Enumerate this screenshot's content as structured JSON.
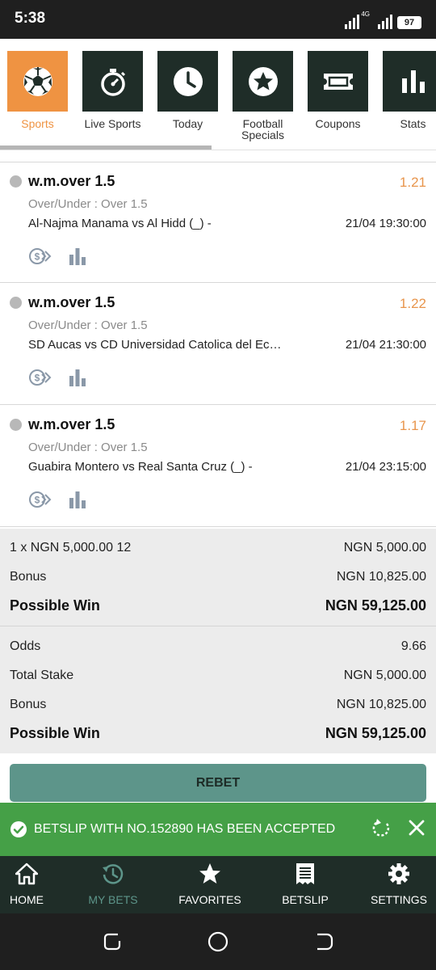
{
  "status_bar": {
    "time": "5:38",
    "network": "4G",
    "battery": "97"
  },
  "categories": [
    {
      "label": "Sports",
      "icon": "soccer-ball-icon",
      "active": true
    },
    {
      "label": "Live Sports",
      "icon": "stopwatch-icon",
      "active": false
    },
    {
      "label": "Today",
      "icon": "clock-icon",
      "active": false
    },
    {
      "label": "Football Specials",
      "icon": "star-icon",
      "active": false
    },
    {
      "label": "Coupons",
      "icon": "ticket-icon",
      "active": false
    },
    {
      "label": "Stats",
      "icon": "bar-chart-icon",
      "active": false
    }
  ],
  "bets": [
    {
      "title": "w.m.over 1.5",
      "odds": "1.21",
      "market": "Over/Under : Over 1.5",
      "match": "Al-Najma Manama vs Al Hidd (_) -",
      "time": "21/04 19:30:00"
    },
    {
      "title": "w.m.over 1.5",
      "odds": "1.22",
      "market": "Over/Under : Over 1.5",
      "match": "SD Aucas vs CD Universidad Catolica del Ecuador (_) -",
      "time": "21/04 21:30:00"
    },
    {
      "title": "w.m.over 1.5",
      "odds": "1.17",
      "market": "Over/Under : Over 1.5",
      "match": "Guabira Montero vs Real Santa Cruz (_) -",
      "time": "21/04 23:15:00"
    }
  ],
  "summary": {
    "stake_line": {
      "label": "1 x NGN 5,000.00 12",
      "value": "NGN 5,000.00"
    },
    "bonus_1": {
      "label": "Bonus",
      "value": "NGN 10,825.00"
    },
    "possible_win_1": {
      "label": "Possible Win",
      "value": "NGN 59,125.00"
    },
    "odds": {
      "label": "Odds",
      "value": "9.66"
    },
    "total_stake": {
      "label": "Total Stake",
      "value": "NGN 5,000.00"
    },
    "bonus_2": {
      "label": "Bonus",
      "value": "NGN 10,825.00"
    },
    "possible_win_2": {
      "label": "Possible Win",
      "value": "NGN 59,125.00"
    }
  },
  "rebet_label": "REBET",
  "toast": {
    "message": "BETSLIP WITH NO.152890 HAS BEEN ACCEPTED"
  },
  "bottom_nav": [
    {
      "label": "HOME",
      "icon": "home-icon",
      "active": false
    },
    {
      "label": "MY BETS",
      "icon": "my-bets-icon",
      "active": true
    },
    {
      "label": "FAVORITES",
      "icon": "star-icon",
      "active": false
    },
    {
      "label": "BETSLIP",
      "icon": "betslip-icon",
      "active": false
    },
    {
      "label": "SETTINGS",
      "icon": "gear-icon",
      "active": false
    }
  ],
  "colors": {
    "accent": "#ef9342",
    "dark": "#1f2d28",
    "rebet": "#5d958a",
    "toast": "#45a047",
    "odds": "#e8954c"
  }
}
